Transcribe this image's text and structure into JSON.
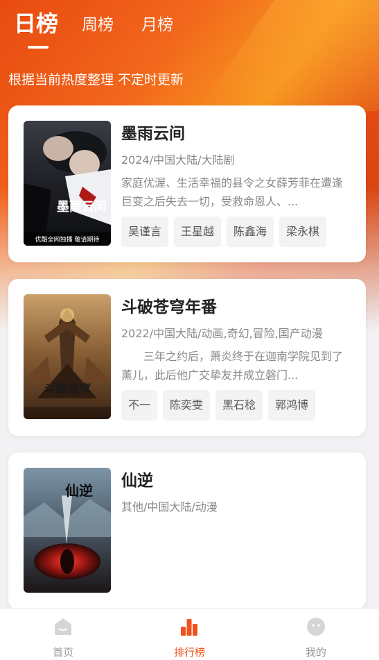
{
  "tabs": {
    "active": "日榜",
    "items": [
      "周榜",
      "月榜"
    ]
  },
  "subtitle": "根据当前热度整理 不定时更新",
  "cards": [
    {
      "title": "墨雨云间",
      "meta": "2024/中国大陆/大陆剧",
      "desc": "家庭优渥、生活幸福的县令之女薛芳菲在遭逢巨变之后失去一切，受救命恩人、...",
      "tags": [
        "吴谨言",
        "王星越",
        "陈鑫海",
        "梁永棋"
      ],
      "poster": {
        "title": "墨雨云间",
        "caption": "优酷全网独播 敬请期待"
      }
    },
    {
      "title": "斗破苍穹年番",
      "meta": "2022/中国大陆/动画,奇幻,冒险,国产动漫",
      "desc": "　　三年之约后，萧炎终于在迦南学院见到了薰儿，此后他广交挚友并成立磐门...",
      "tags": [
        "不一",
        "陈奕雯",
        "黑石稔",
        "郭鸿博"
      ],
      "poster": {
        "title": "斗破苍穹"
      }
    },
    {
      "title": "仙逆",
      "meta": "其他/中国大陆/动漫",
      "desc": "",
      "tags": [],
      "poster": {
        "title": "仙逆"
      }
    }
  ],
  "bottom_nav": {
    "home": "首页",
    "ranking": "排行榜",
    "mine": "我的"
  },
  "colors": {
    "accent": "#f1521d",
    "hero_start": "#e84a10",
    "hero_mid": "#f7951e"
  },
  "icons": {
    "home": "home-icon",
    "ranking": "bar-chart-icon",
    "mine": "smiley-face-icon"
  }
}
